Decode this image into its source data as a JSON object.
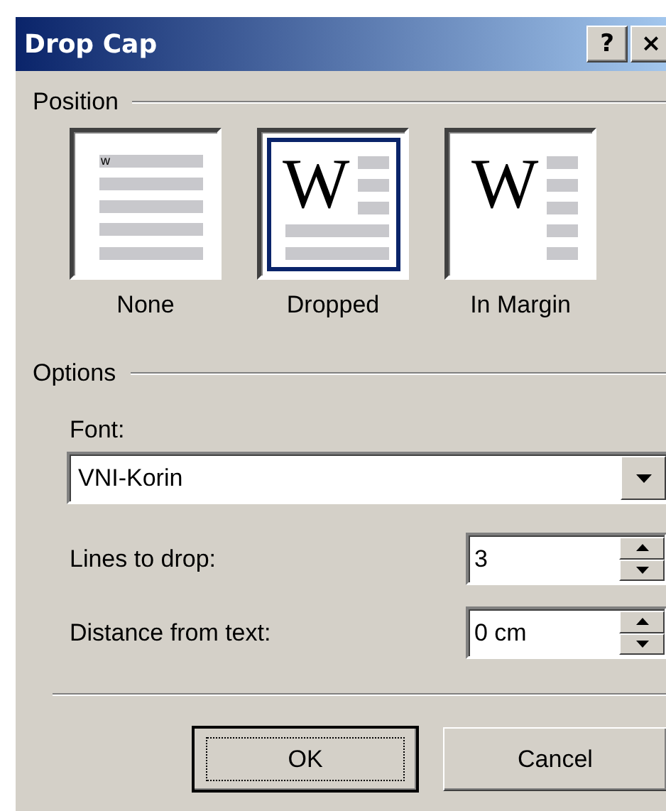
{
  "window": {
    "title": "Drop Cap",
    "buttons": [
      "?",
      "×"
    ]
  },
  "position": {
    "label": "Position",
    "options": [
      {
        "label": "None",
        "kind": "none",
        "glyph": "w",
        "selected": false
      },
      {
        "label": "Dropped",
        "kind": "dropped",
        "glyph": "W",
        "selected": true
      },
      {
        "label": "In Margin",
        "kind": "margin",
        "glyph": "W",
        "selected": false
      }
    ]
  },
  "options": {
    "label": "Options",
    "font": {
      "label": "Font:",
      "value": "VNI-Korin"
    },
    "spinners": [
      {
        "label": "Lines to drop:",
        "value": "3"
      },
      {
        "label": "Distance from text:",
        "value": "0 cm"
      }
    ]
  },
  "buttons": [
    {
      "label": "OK",
      "default": true
    },
    {
      "label": "Cancel",
      "default": false
    }
  ]
}
